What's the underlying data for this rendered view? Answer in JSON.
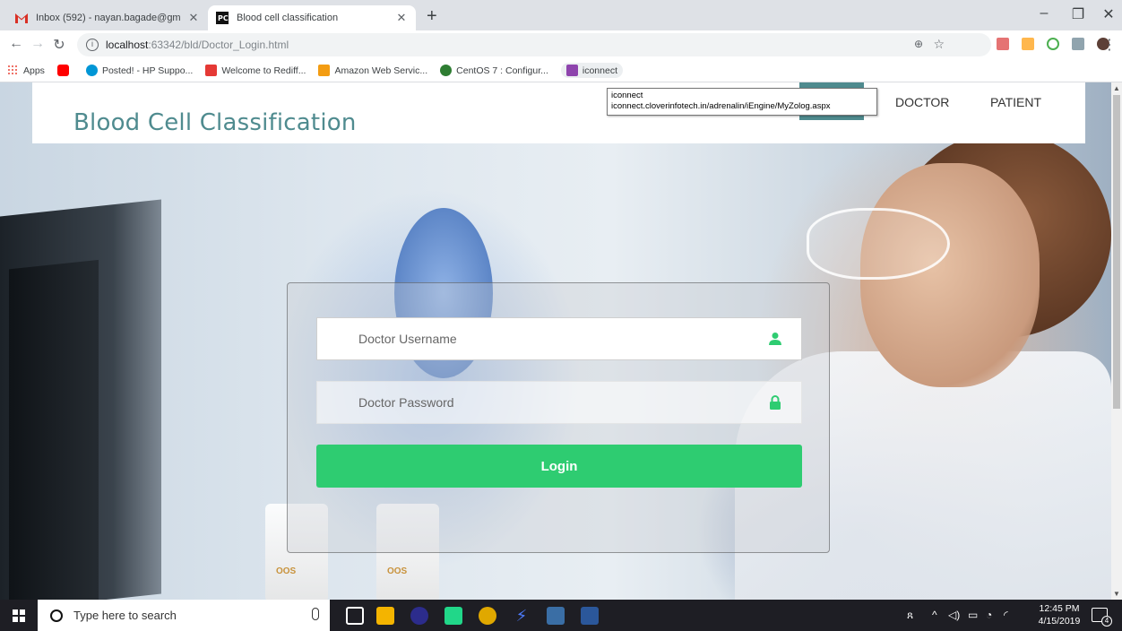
{
  "browser": {
    "tabs": [
      {
        "title": "Inbox (592) - nayan.bagade@gm",
        "active": false
      },
      {
        "title": "Blood cell classification",
        "active": true
      }
    ],
    "new_tab": "+",
    "url_host": "localhost",
    "url_path": ":63342/bld/Doctor_Login.html"
  },
  "bookmarks": [
    {
      "label": "Apps",
      "color": "#e8453c"
    },
    {
      "label": "",
      "color": "#ff0000"
    },
    {
      "label": "Posted! - HP Suppo...",
      "color": "#0096d6"
    },
    {
      "label": "Welcome to Rediff...",
      "color": "#e53935"
    },
    {
      "label": "Amazon Web Servic...",
      "color": "#f39c12"
    },
    {
      "label": "CentOS 7 : Configur...",
      "color": "#2e7d32"
    },
    {
      "label": "iconnect",
      "color": "#8e44ad"
    }
  ],
  "tooltip": {
    "line1": "iconnect",
    "line2": "iconnect.cloverinfotech.in/adrenalin/iEngine/MyZolog.aspx"
  },
  "site": {
    "brand": "Blood Cell Classification",
    "nav": [
      "DOCTOR",
      "PATIENT"
    ],
    "accent": "#4f8b8f"
  },
  "login": {
    "username_placeholder": "Doctor Username",
    "password_placeholder": "Doctor Password",
    "button": "Login",
    "button_color": "#2ecc71"
  },
  "images": {
    "bottle_labels": [
      "OOS",
      "OOS"
    ]
  },
  "taskbar": {
    "search_placeholder": "Type here to search",
    "time": "12:45 PM",
    "date": "4/15/2019",
    "notifications": "4"
  }
}
